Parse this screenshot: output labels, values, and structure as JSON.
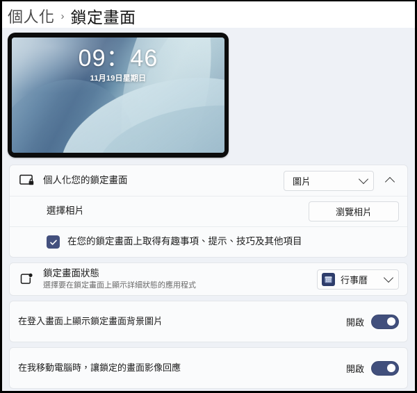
{
  "breadcrumb": {
    "parent": "個人化",
    "separator": "›",
    "current": "鎖定畫面"
  },
  "preview": {
    "name": "lock-screen-preview",
    "time": "09：46",
    "date": "11月19日星期日",
    "wallpaper": "windows-bloom-blue"
  },
  "settings": {
    "personalize": {
      "icon": "lock-screen-icon",
      "title": "個人化您的鎖定畫面",
      "dropdown_value": "圖片",
      "expander_icon": "chevron-up-icon",
      "choose_photo": {
        "title": "選擇相片",
        "button_label": "瀏覽相片"
      },
      "fun_facts": {
        "label": "在您的鎖定畫面上取得有趣事項、提示、技巧及其他項目",
        "checked": true
      }
    },
    "status": {
      "icon": "lock-screen-status-icon",
      "title": "鎖定畫面狀態",
      "subtitle": "選擇要在鎖定畫面上顯示詳細狀態的應用程式",
      "app_icon": "calendar-app-icon",
      "dropdown_value": "行事曆"
    },
    "signin_background": {
      "title": "在登入畫面上顯示鎖定畫面背景圖片",
      "state_label": "開啟",
      "on": true
    },
    "motion_response": {
      "title": "在我移動電腦時，讓鎖定的畫面影像回應",
      "state_label": "開啟",
      "on": true
    }
  },
  "colors": {
    "page_background": "#eef1f6",
    "card_background": "#fafbfc",
    "accent_toggle": "#414f7c",
    "accent_checkbox": "#43507e",
    "app_tile": "#2e3d6b"
  }
}
